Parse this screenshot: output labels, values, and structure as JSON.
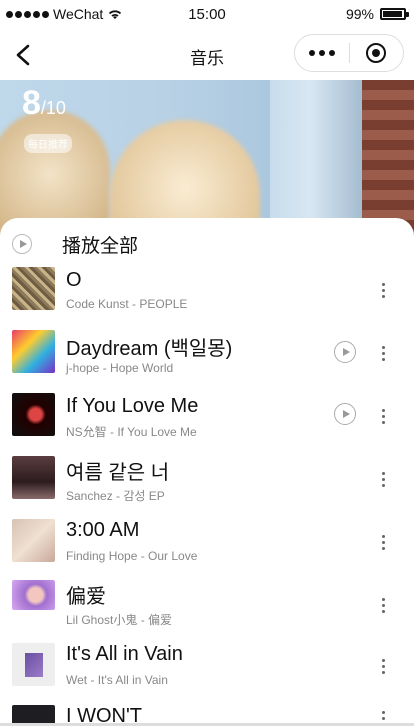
{
  "status_bar": {
    "carrier": "WeChat",
    "time": "15:00",
    "battery": "99%"
  },
  "nav": {
    "title": "音乐"
  },
  "banner": {
    "rank": "8",
    "rank_total": "/10",
    "badge": "每日推荐"
  },
  "list": {
    "play_all_label": "播放全部",
    "songs": [
      {
        "title": "O",
        "subtitle": "Code Kunst - PEOPLE",
        "has_mv": false
      },
      {
        "title": "Daydream (백일몽)",
        "subtitle": "j-hope - Hope World",
        "has_mv": true
      },
      {
        "title": "If You Love Me",
        "subtitle": "NS允智 - If You Love Me",
        "has_mv": true
      },
      {
        "title": "여름 같은 너",
        "subtitle": "Sanchez - 감성 EP",
        "has_mv": false
      },
      {
        "title": "3:00 AM",
        "subtitle": "Finding Hope - Our Love",
        "has_mv": false
      },
      {
        "title": "偏爱",
        "subtitle": "Lil Ghost小鬼 - 偏爱",
        "has_mv": false
      },
      {
        "title": "It's All in Vain",
        "subtitle": "Wet - It's All in Vain",
        "has_mv": false
      },
      {
        "title": "I WON'T",
        "subtitle": "",
        "has_mv": false
      }
    ]
  },
  "colors": {
    "accent_text": "#111111",
    "subtitle": "#888888",
    "background": "#ffffff"
  }
}
